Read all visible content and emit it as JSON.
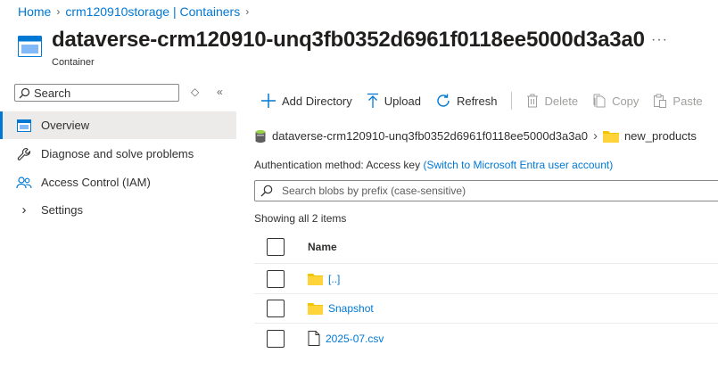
{
  "breadcrumb": {
    "home": "Home",
    "storage": "crm120910storage | Containers"
  },
  "header": {
    "title": "dataverse-crm120910-unq3fb0352d6961f0118ee5000d3a3a0",
    "subtitle": "Container",
    "more": "···"
  },
  "sidebar": {
    "search_placeholder": "Search",
    "items": [
      {
        "label": "Overview",
        "icon": "container-icon",
        "active": true
      },
      {
        "label": "Diagnose and solve problems",
        "icon": "wrench-icon"
      },
      {
        "label": "Access Control (IAM)",
        "icon": "people-icon"
      },
      {
        "label": "Settings",
        "icon": "chevron-right-icon"
      }
    ]
  },
  "toolbar": {
    "add_directory": "Add Directory",
    "upload": "Upload",
    "refresh": "Refresh",
    "delete": "Delete",
    "copy": "Copy",
    "paste": "Paste"
  },
  "path": {
    "container": "dataverse-crm120910-unq3fb0352d6961f0118ee5000d3a3a0",
    "folder": "new_products"
  },
  "auth": {
    "label": "Authentication method:",
    "value": "Access key",
    "switch_link": "(Switch to Microsoft Entra user account)"
  },
  "blob_search": {
    "placeholder": "Search blobs by prefix (case-sensitive)"
  },
  "listing": {
    "showing": "Showing all 2 items",
    "column_name": "Name",
    "rows": [
      {
        "name": "[..]",
        "type": "folder"
      },
      {
        "name": "Snapshot",
        "type": "folder"
      },
      {
        "name": "2025-07.csv",
        "type": "file"
      }
    ]
  },
  "colors": {
    "accent": "#0078d4",
    "folder": "#f2c500",
    "active_bg": "#edebe9"
  }
}
